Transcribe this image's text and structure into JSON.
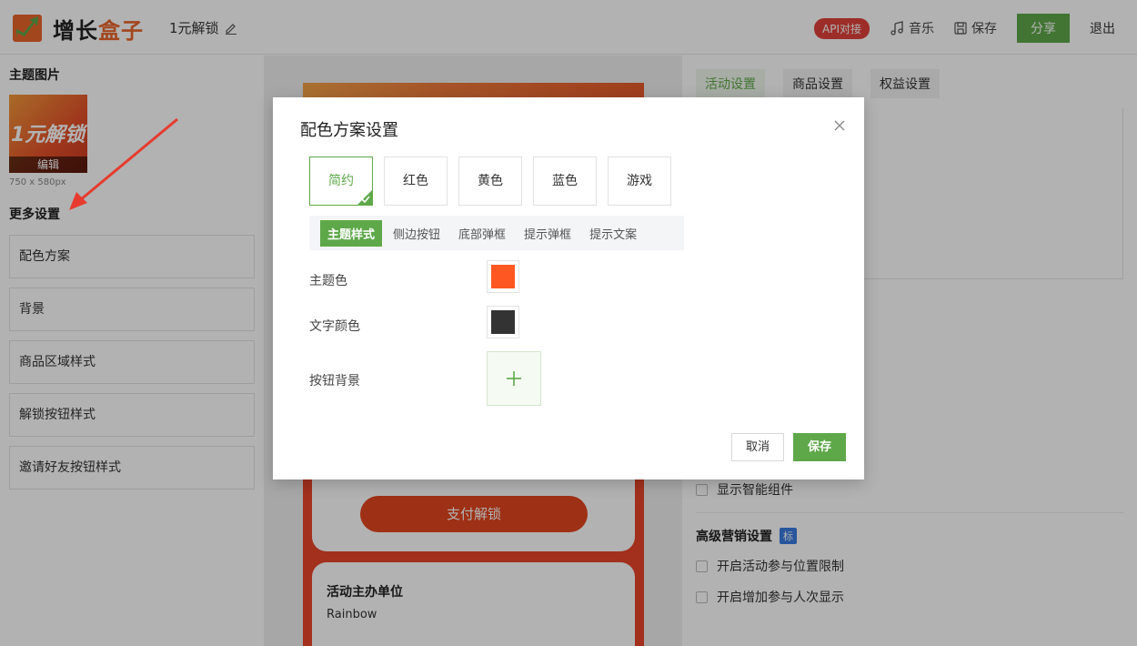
{
  "header": {
    "brand_part1": "增长",
    "brand_part2": "盒子",
    "doc_title": "1元解锁",
    "api_badge": "API对接",
    "music": "音乐",
    "save": "保存",
    "share": "分享",
    "logout": "退出"
  },
  "left": {
    "theme_image_title": "主题图片",
    "thumb_text": "1元解锁",
    "thumb_edit": "编辑",
    "thumb_size": "750 x 580px",
    "more_settings_title": "更多设置",
    "menu": [
      {
        "label": "配色方案"
      },
      {
        "label": "背景"
      },
      {
        "label": "商品区域样式"
      },
      {
        "label": "解锁按钮样式"
      },
      {
        "label": "邀请好友按钮样式"
      }
    ]
  },
  "preview": {
    "pay_button": "支付解锁",
    "org_title": "活动主办单位",
    "org_name": "Rainbow"
  },
  "right": {
    "tabs": [
      {
        "label": "活动设置",
        "active": true
      },
      {
        "label": "商品设置",
        "active": false
      },
      {
        "label": "权益设置",
        "active": false
      }
    ],
    "show_smart_component": "显示智能组件",
    "advanced_title": "高级营销设置",
    "advanced_tag": "标",
    "option_location_limit": "开启活动参与位置限制",
    "option_participant_count": "开启增加参与人次显示"
  },
  "modal": {
    "title": "配色方案设置",
    "schemes": [
      {
        "label": "简约",
        "active": true
      },
      {
        "label": "红色",
        "active": false
      },
      {
        "label": "黄色",
        "active": false
      },
      {
        "label": "蓝色",
        "active": false
      },
      {
        "label": "游戏",
        "active": false
      }
    ],
    "subtabs": [
      {
        "label": "主题样式",
        "active": true
      },
      {
        "label": "侧边按钮",
        "active": false
      },
      {
        "label": "底部弹框",
        "active": false
      },
      {
        "label": "提示弹框",
        "active": false
      },
      {
        "label": "提示文案",
        "active": false
      }
    ],
    "theme_color_label": "主题色",
    "theme_color": "#ff5722",
    "text_color_label": "文字颜色",
    "text_color": "#333333",
    "button_bg_label": "按钮背景",
    "cancel": "取消",
    "save": "保存"
  },
  "colors": {
    "accent": "#5fa84a",
    "brand_orange": "#e8652b",
    "api_red": "#e0413a"
  }
}
